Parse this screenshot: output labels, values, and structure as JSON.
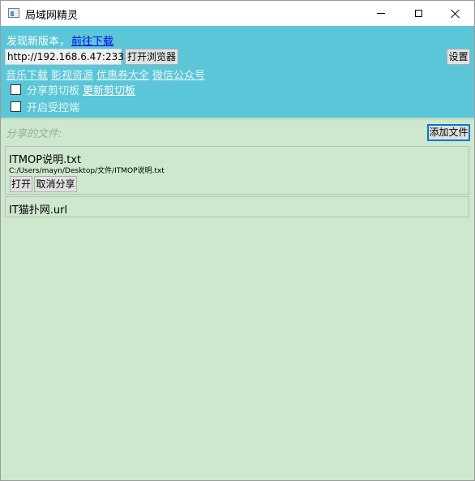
{
  "window": {
    "title": "局域网精灵"
  },
  "header": {
    "update_text": "发现新版本，",
    "update_link": "前往下载",
    "url": "http://192.168.6.47:2333",
    "open_browser_label": "打开浏览器",
    "settings_label": "设置",
    "links": [
      "音乐下载",
      "影视资源",
      "优惠券大全",
      "微信公众号"
    ],
    "share_clipboard_label": "分享剪切板",
    "refresh_clipboard_label": "更新剪切板",
    "remote_control_label": "开启受控端"
  },
  "main": {
    "shared_files_label": "分享的文件:",
    "add_file_label": "添加文件",
    "files": [
      {
        "name": "ITMOP说明.txt",
        "path": "C:/Users/mayn/Desktop/文件/ITMOP说明.txt",
        "open_label": "打开",
        "unshare_label": "取消分享"
      },
      {
        "name": "IT猫扑网.url"
      }
    ]
  },
  "colors": {
    "header_bg": "#5bc6d8",
    "body_bg": "#cde8cd",
    "link": "#0000ee"
  }
}
